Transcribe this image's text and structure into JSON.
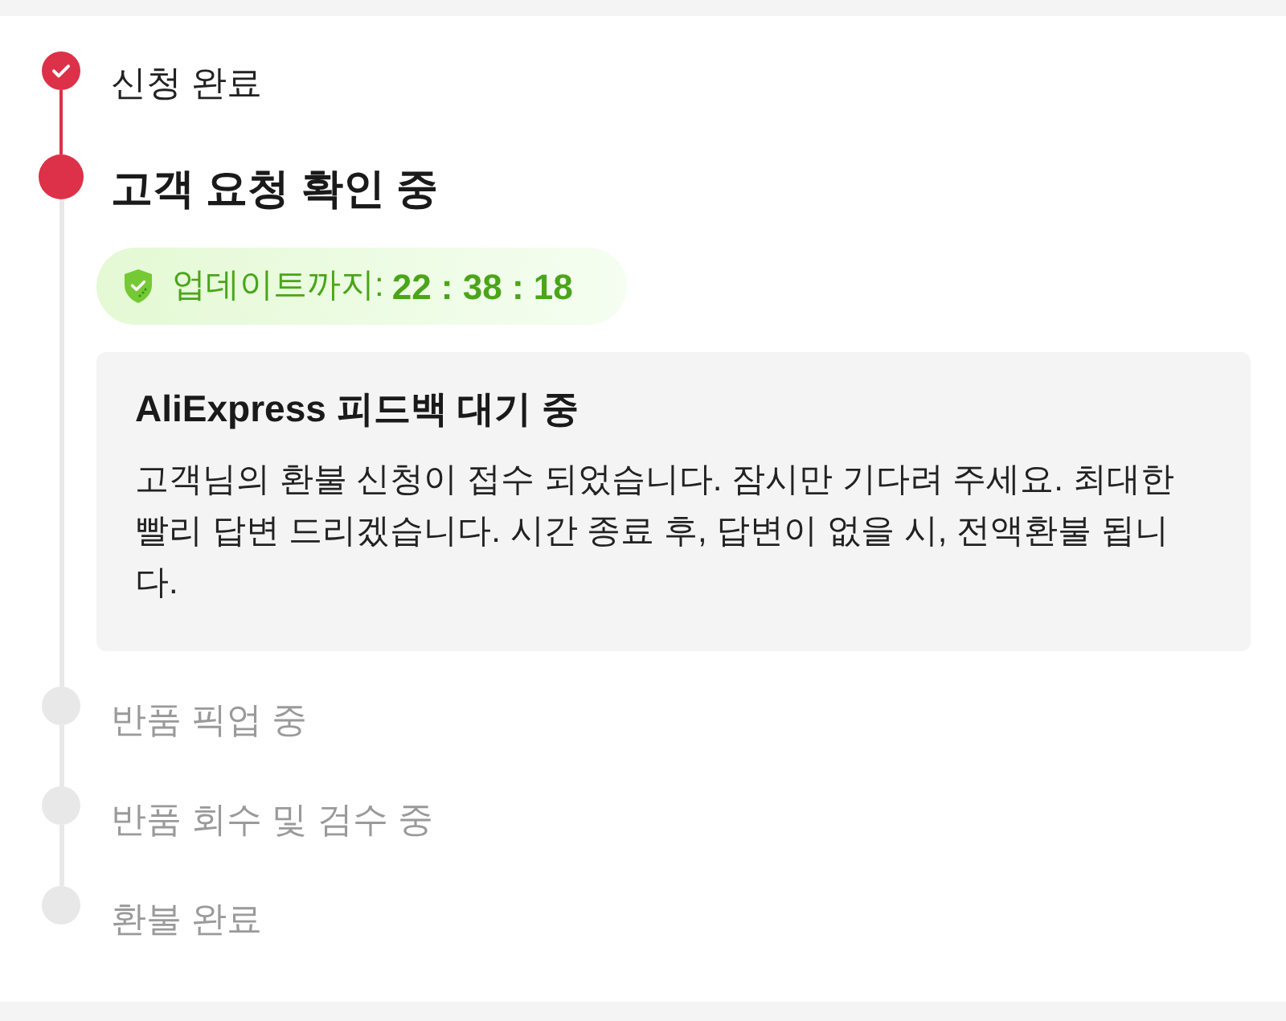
{
  "steps": [
    {
      "label": "신청 완료",
      "kind": "done"
    },
    {
      "label": "고객 요청 확인 중",
      "kind": "current",
      "timer": {
        "label": "업데이트까지:",
        "value": "22 : 38 : 18"
      },
      "notice": {
        "title": "AliExpress 피드백 대기 중",
        "body": "고객님의 환불 신청이 접수 되었습니다. 잠시만 기다려 주세요. 최대한 빨리 답변 드리겠습니다. 시간 종료 후, 답변이 없을 시, 전액환불 됩니다."
      }
    },
    {
      "label": "반품 픽업 중",
      "kind": "pending"
    },
    {
      "label": "반품 회수 및 검수 중",
      "kind": "pending"
    },
    {
      "label": "환불 완료",
      "kind": "pending"
    }
  ]
}
